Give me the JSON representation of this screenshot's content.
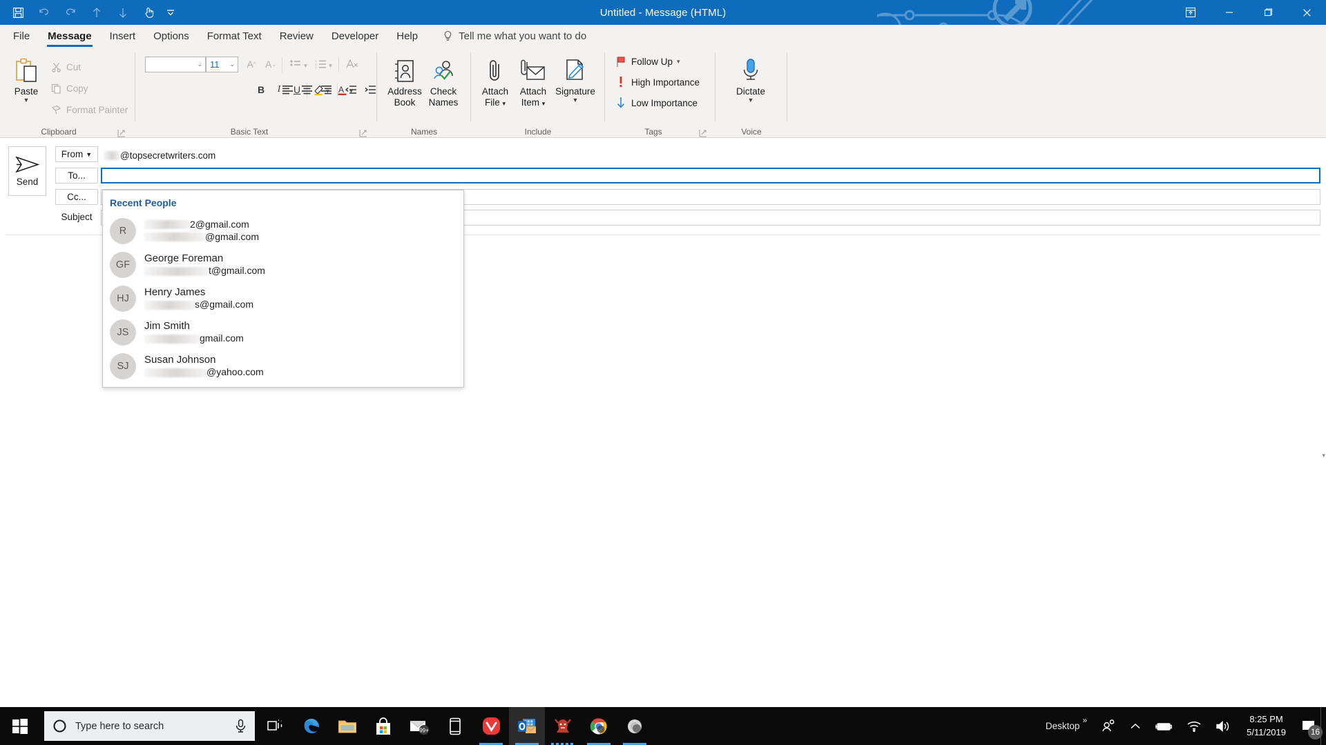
{
  "window": {
    "title": "Untitled  -  Message (HTML)",
    "quick_access": [
      {
        "name": "save-icon",
        "tip": "Save"
      },
      {
        "name": "undo-icon",
        "tip": "Undo"
      },
      {
        "name": "redo-icon",
        "tip": "Redo"
      },
      {
        "name": "previous-item-icon",
        "tip": "Previous Item"
      },
      {
        "name": "next-item-icon",
        "tip": "Next Item"
      },
      {
        "name": "touch-mouse-mode-icon",
        "tip": "Touch/Mouse Mode"
      }
    ],
    "controls": {
      "ribbon_display_options": "Ribbon Display Options",
      "minimize": "Minimize",
      "restore": "Restore Down",
      "close": "Close"
    }
  },
  "ribbon": {
    "tabs": [
      {
        "label": "File",
        "active": false
      },
      {
        "label": "Message",
        "active": true
      },
      {
        "label": "Insert",
        "active": false
      },
      {
        "label": "Options",
        "active": false
      },
      {
        "label": "Format Text",
        "active": false
      },
      {
        "label": "Review",
        "active": false
      },
      {
        "label": "Developer",
        "active": false
      },
      {
        "label": "Help",
        "active": false
      }
    ],
    "tell_me": "Tell me what you want to do",
    "groups": [
      {
        "label": "Clipboard",
        "has_dialog_launcher": true
      },
      {
        "label": "Basic Text",
        "has_dialog_launcher": true
      },
      {
        "label": "Names",
        "has_dialog_launcher": false
      },
      {
        "label": "Include",
        "has_dialog_launcher": false
      },
      {
        "label": "Tags",
        "has_dialog_launcher": true
      },
      {
        "label": "Voice",
        "has_dialog_launcher": false
      }
    ],
    "clipboard": {
      "paste": "Paste",
      "cut": "Cut",
      "copy": "Copy",
      "format_painter": "Format Painter"
    },
    "basic_text": {
      "font_name": "",
      "font_size": "11"
    },
    "names": {
      "address_book_line1": "Address",
      "address_book_line2": "Book",
      "check_names_line1": "Check",
      "check_names_line2": "Names"
    },
    "include": {
      "attach_file_line1": "Attach",
      "attach_file_line2": "File",
      "attach_item_line1": "Attach",
      "attach_item_line2": "Item",
      "signature": "Signature"
    },
    "tags": {
      "follow_up": "Follow Up",
      "high_importance": "High Importance",
      "low_importance": "Low Importance"
    },
    "voice": {
      "dictate": "Dictate"
    }
  },
  "compose": {
    "send_label": "Send",
    "from_label": "From",
    "from_value_suffix": "@topsecretwriters.com",
    "to_label": "To...",
    "to_value": "",
    "cc_label": "Cc...",
    "cc_value": "",
    "subject_label": "Subject",
    "subject_value": "",
    "body_value": ""
  },
  "autocomplete": {
    "title": "Recent People",
    "entries": [
      {
        "initials": "R",
        "name": "",
        "email_suffix": "2@gmail.com",
        "email_second_line": "@gmail.com",
        "redacted_name_width": 0,
        "redacted_email_width": 66
      },
      {
        "initials": "GF",
        "name": "George Foreman",
        "email_suffix": "t@gmail.com",
        "email_second_line": "",
        "redacted_name_width": 0,
        "redacted_email_width": 93
      },
      {
        "initials": "HJ",
        "name": "Henry James",
        "email_suffix": "s@gmail.com",
        "email_second_line": "",
        "redacted_name_width": 0,
        "redacted_email_width": 73
      },
      {
        "initials": "JS",
        "name": "Jim Smith",
        "email_suffix": "gmail.com",
        "email_second_line": "",
        "redacted_name_width": 0,
        "redacted_email_width": 80
      },
      {
        "initials": "SJ",
        "name": "Susan Johnson",
        "email_suffix": "@yahoo.com",
        "email_second_line": "",
        "redacted_name_width": 0,
        "redacted_email_width": 90
      }
    ]
  },
  "taskbar": {
    "start": "Start",
    "search_placeholder": "Type here to search",
    "cortana_icon": "cortana-circle-icon",
    "mic_icon": "microphone-icon",
    "buttons": [
      {
        "name": "task-view-icon",
        "label": "Task View",
        "active": false,
        "running": false
      },
      {
        "name": "edge-icon",
        "label": "Microsoft Edge",
        "active": false,
        "running": false
      },
      {
        "name": "file-explorer-icon",
        "label": "File Explorer",
        "active": false,
        "running": false
      },
      {
        "name": "microsoft-store-icon",
        "label": "Microsoft Store",
        "active": false,
        "running": false
      },
      {
        "name": "mail-icon",
        "label": "Mail",
        "badge": "99+",
        "active": false,
        "running": false
      },
      {
        "name": "your-phone-icon",
        "label": "Your Phone",
        "active": false,
        "running": false
      },
      {
        "name": "vivaldi-icon",
        "label": "Vivaldi",
        "active": false,
        "running": true
      },
      {
        "name": "outlook-icon",
        "label": "Outlook",
        "active": true,
        "running": true
      },
      {
        "name": "mascot-app-icon",
        "label": "Application",
        "active": false,
        "running": true
      },
      {
        "name": "chrome-icon",
        "label": "Google Chrome",
        "active": false,
        "running": true
      },
      {
        "name": "grey-app-icon",
        "label": "Application",
        "active": false,
        "running": true
      }
    ],
    "tray": {
      "desktop_label": "Desktop",
      "overflow_icon": "chevron-double-right-icon",
      "people_icon": "people-icon",
      "show_hidden_icon": "chevron-up-icon",
      "battery_icon": "battery-charging-icon",
      "network_icon": "wifi-icon",
      "volume_icon": "speaker-icon",
      "time": "8:25 PM",
      "date": "5/11/2019",
      "notification_count": "16"
    }
  },
  "colors": {
    "title_bar": "#0f6cbd",
    "ribbon_bg": "#f3f2f1",
    "accent": "#0f6cbd",
    "header_blue": "#1f5aa6",
    "taskbar": "#0a0a0a",
    "importance_red": "#d83b01",
    "low_importance_blue": "#2b88d8"
  }
}
